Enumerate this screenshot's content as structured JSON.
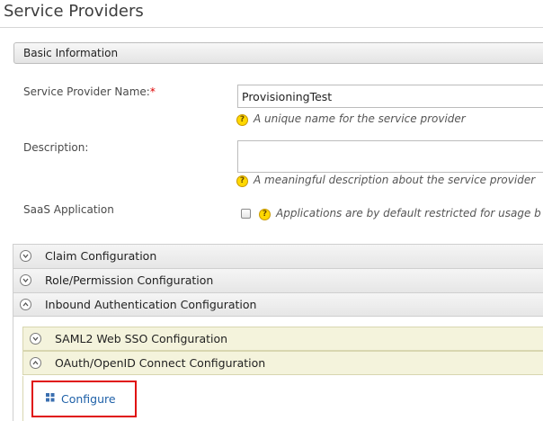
{
  "page": {
    "title": "Service Providers"
  },
  "basic_info": {
    "header": "Basic Information",
    "name_label": "Service Provider Name:",
    "required_mark": "*",
    "name_value": "ProvisioningTest",
    "name_help": "A unique name for the service provider",
    "description_label": "Description:",
    "description_value": "",
    "description_help": "A meaningful description about the service provider",
    "saas_label": "SaaS Application",
    "saas_checked": false,
    "saas_help": "Applications are by default restricted for usage b"
  },
  "sections": {
    "claim": "Claim Configuration",
    "role": "Role/Permission Configuration",
    "inbound": "Inbound Authentication Configuration",
    "saml": "SAML2 Web SSO Configuration",
    "oauth": "OAuth/OpenID Connect Configuration",
    "configure_link": "Configure"
  },
  "icons": {
    "help": "question-circle-icon",
    "expand": "chevron-down-icon",
    "collapse": "chevron-up-icon",
    "configure": "grid-icon"
  },
  "colors": {
    "link": "#1f61a8",
    "highlight_box": "#e01010",
    "help_icon": "#ffd800",
    "sub_section_bg": "#f4f3dc"
  }
}
